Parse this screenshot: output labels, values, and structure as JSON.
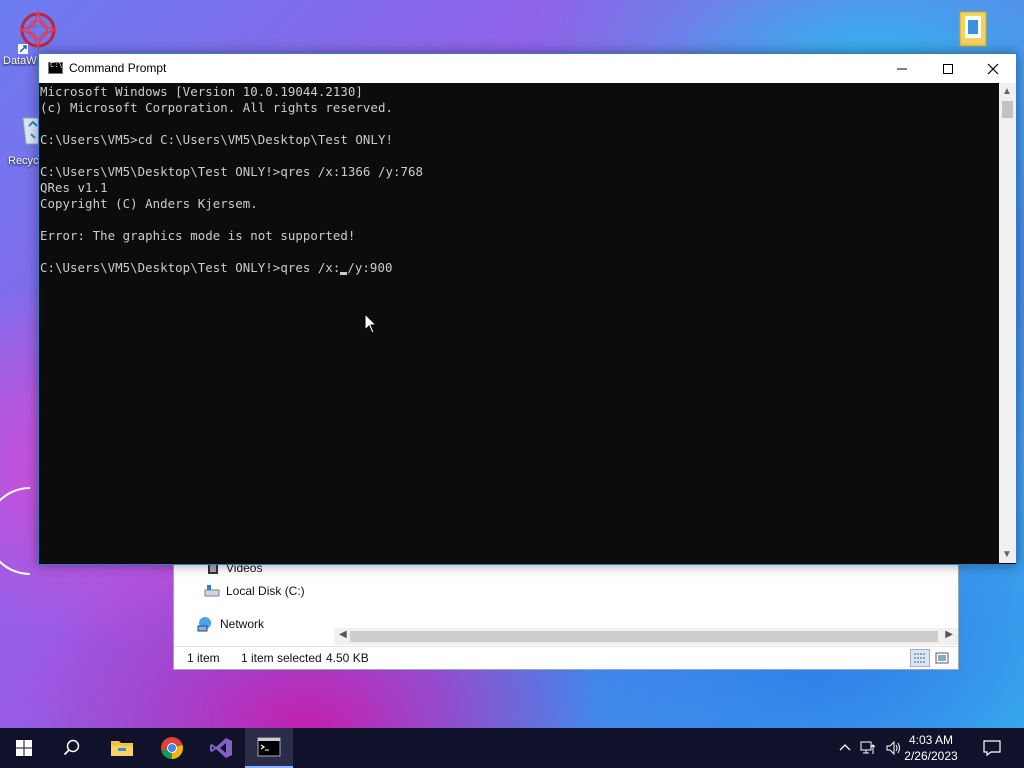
{
  "desktop": {
    "icon1_label": "DataW",
    "icon2_label": "Recyc"
  },
  "cmd": {
    "title": "Command Prompt",
    "minimize": "—",
    "maximize": "☐",
    "close": "✕",
    "lines": [
      "Microsoft Windows [Version 10.0.19044.2130]",
      "(c) Microsoft Corporation. All rights reserved.",
      "",
      "C:\\Users\\VM5>cd C:\\Users\\VM5\\Desktop\\Test ONLY!",
      "",
      "C:\\Users\\VM5\\Desktop\\Test ONLY!>qres /x:1366 /y:768",
      "QRes v1.1",
      "Copyright (C) Anders Kjersem.",
      "",
      "Error: The graphics mode is not supported!",
      ""
    ],
    "input_before_cursor": "C:\\Users\\VM5\\Desktop\\Test ONLY!>qres /x:",
    "input_after_cursor": "/y:900"
  },
  "explorer": {
    "tree": {
      "videos": "Videos",
      "local_disk": "Local Disk (C:)",
      "network": "Network"
    },
    "status": {
      "item_count": "1 item",
      "selection": "1 item selected",
      "size": "4.50 KB"
    }
  },
  "taskbar": {
    "time": "4:03 AM",
    "date": "2/26/2023"
  },
  "icons": {
    "start": "windows-logo-icon",
    "search": "search-icon",
    "explorer": "folder-icon",
    "chrome": "chrome-icon",
    "vs": "visual-studio-icon",
    "cmd": "command-prompt-icon"
  },
  "colors": {
    "console_bg": "#0c0c0c",
    "console_text": "#cccccc",
    "taskbar_bg": "#10112b"
  }
}
